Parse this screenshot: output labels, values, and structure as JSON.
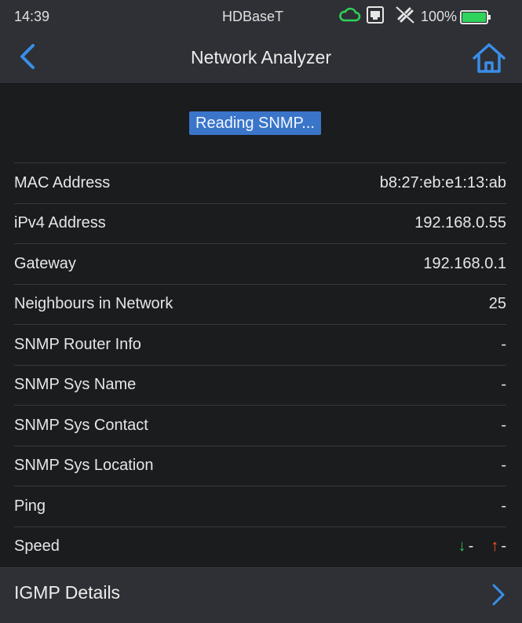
{
  "status_bar": {
    "time": "14:39",
    "center_label": "HDBaseT",
    "battery_percent": "100%",
    "battery_level": 1.0,
    "icons": [
      "cloud-icon",
      "ethernet-port-icon",
      "link-broken-icon",
      "battery-icon"
    ],
    "cloud_color": "#2fd25a"
  },
  "nav": {
    "title": "Network Analyzer",
    "accent": "#3a8ee8"
  },
  "status_badge": "Reading SNMP...",
  "rows": [
    {
      "label": "MAC Address",
      "value": "b8:27:eb:e1:13:ab"
    },
    {
      "label": "iPv4 Address",
      "value": "192.168.0.55"
    },
    {
      "label": "Gateway",
      "value": "192.168.0.1"
    },
    {
      "label": "Neighbours in Network",
      "value": "25"
    },
    {
      "label": "SNMP Router Info",
      "value": "-"
    },
    {
      "label": "SNMP Sys Name",
      "value": "-"
    },
    {
      "label": "SNMP Sys Contact",
      "value": "-"
    },
    {
      "label": "SNMP Sys Location",
      "value": "-"
    },
    {
      "label": "Ping",
      "value": "-"
    }
  ],
  "speed": {
    "label": "Speed",
    "download_value": "-",
    "upload_value": "-",
    "download_color": "#2fbf5a",
    "upload_color": "#ff5a1e"
  },
  "igmp": {
    "label": "IGMP Details"
  }
}
